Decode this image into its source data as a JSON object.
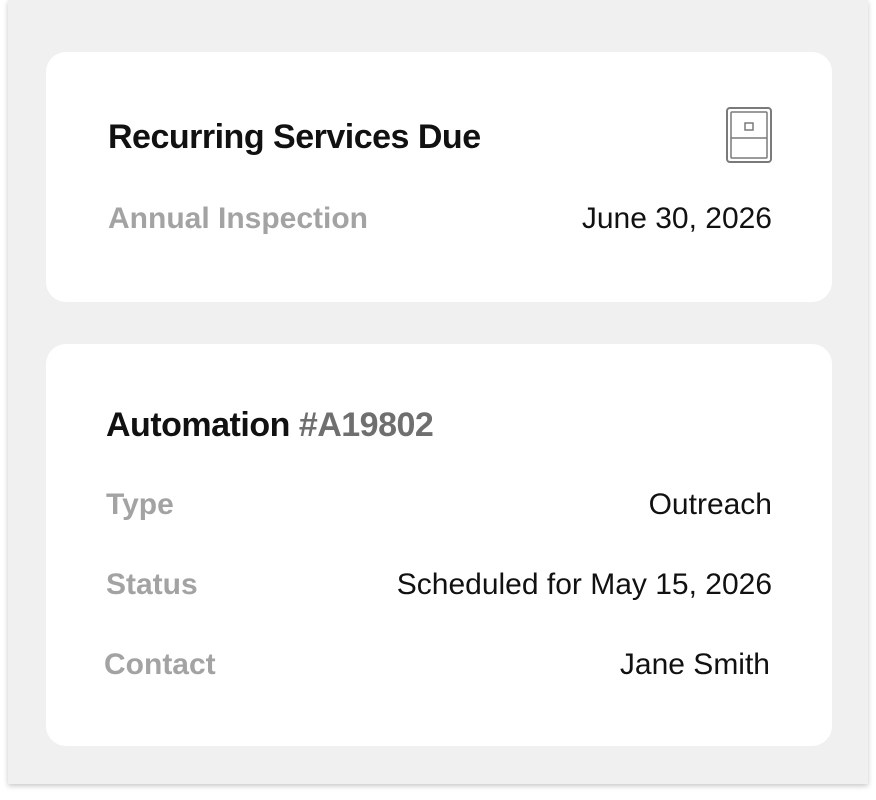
{
  "services_card": {
    "title": "Recurring Services Due",
    "icon": "fridge-icon",
    "rows": [
      {
        "label": "Annual Inspection",
        "value": "June 30, 2026"
      }
    ]
  },
  "automation_card": {
    "title_prefix": "Automation",
    "title_id": "#A19802",
    "rows": [
      {
        "label": "Type",
        "value": "Outreach"
      },
      {
        "label": "Status",
        "value": "Scheduled for May 15, 2026"
      },
      {
        "label": "Contact",
        "value": "Jane Smith"
      }
    ]
  },
  "colors": {
    "panel_background": "#f0f0f0",
    "card_background": "#ffffff",
    "label_gray": "#a3a3a3",
    "id_gray": "#6f6f6f",
    "text_dark": "#111111"
  }
}
